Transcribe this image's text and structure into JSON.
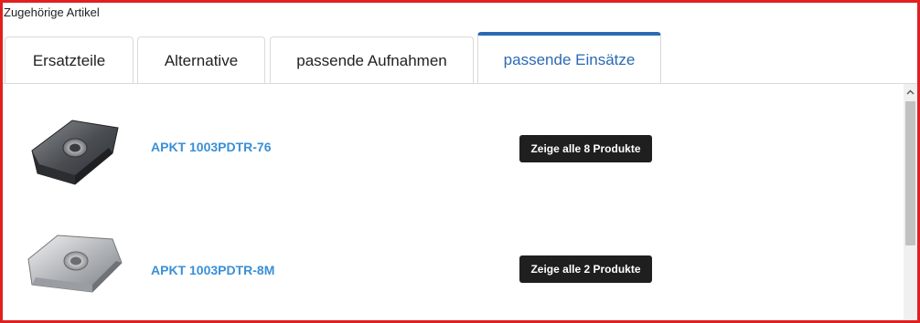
{
  "section": {
    "title": "Zugehörige Artikel"
  },
  "tabs": [
    {
      "label": "Ersatzteile",
      "active": false
    },
    {
      "label": "Alternative",
      "active": false
    },
    {
      "label": "passende Aufnahmen",
      "active": false
    },
    {
      "label": "passende Einsätze",
      "active": true
    }
  ],
  "items": [
    {
      "article": "APKT 1003PDTR-76",
      "button": "Zeige alle 8 Produkte",
      "image": "dark-insert-image"
    },
    {
      "article": "APKT 1003PDTR-8M",
      "button": "Zeige alle 2 Produkte",
      "image": "silver-insert-image"
    }
  ],
  "scrollbar": {
    "up_icon": "chevron-up-icon"
  },
  "colors": {
    "accent": "#2a6ab3",
    "link": "#3a8fd6",
    "button_bg": "#1f1f1f",
    "frame": "#e02020"
  }
}
